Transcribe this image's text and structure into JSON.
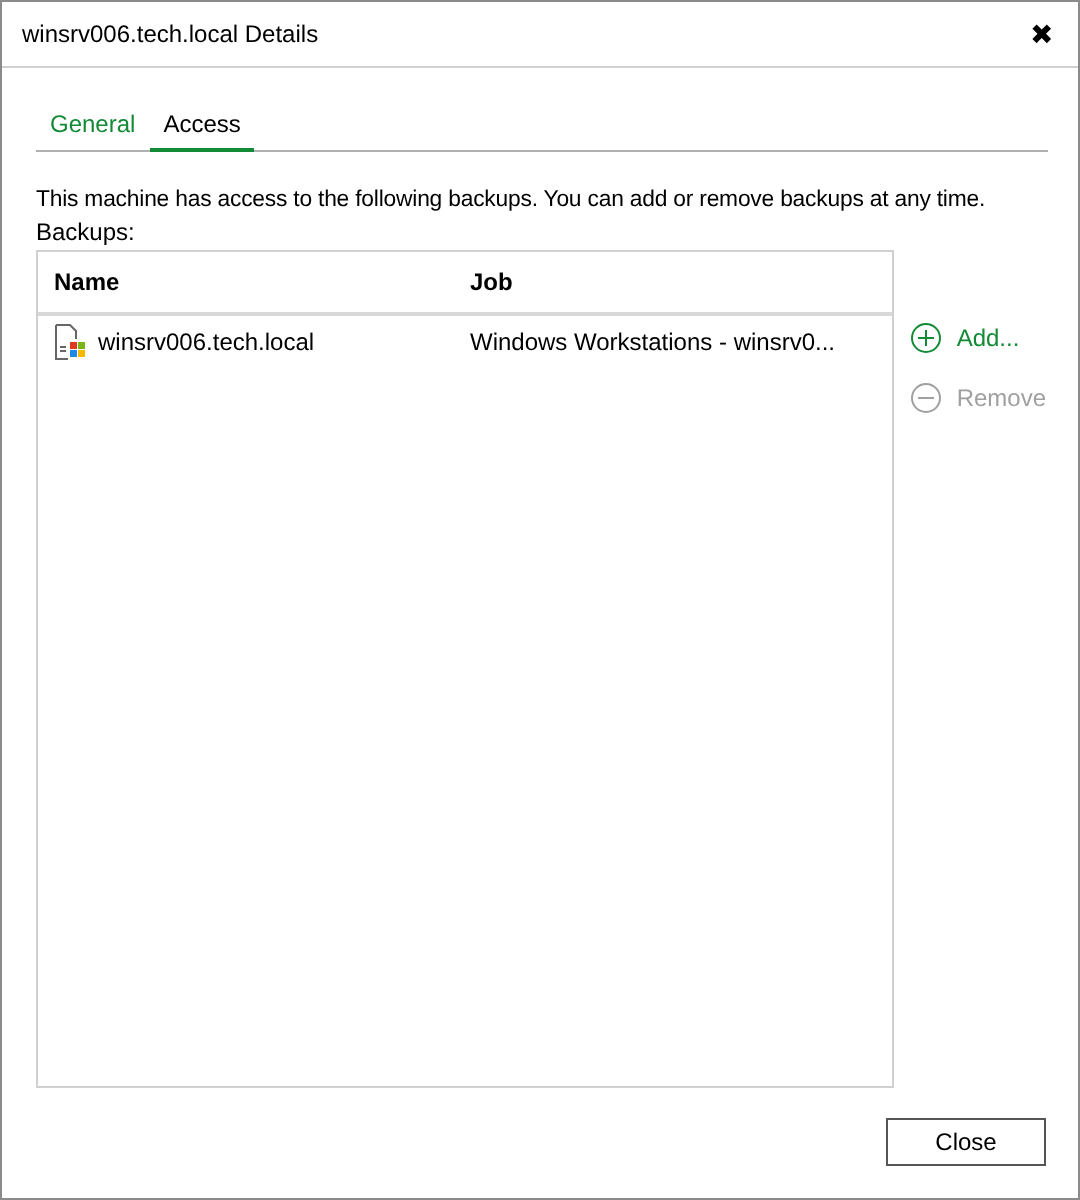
{
  "window": {
    "title": "winsrv006.tech.local Details",
    "close": "✖"
  },
  "tabs": [
    {
      "label": "General",
      "selected": false
    },
    {
      "label": "Access",
      "selected": true
    }
  ],
  "description": "This machine has access to the following backups. You can add or remove backups at any time.",
  "backups_label": "Backups:",
  "table": {
    "columns": [
      "Name",
      "Job"
    ],
    "rows": [
      {
        "name": "winsrv006.tech.local",
        "job": "Windows Workstations - winsrv0...",
        "selected": false
      }
    ]
  },
  "actions": [
    {
      "label": "Add...",
      "kind": "add",
      "disabled": false
    },
    {
      "label": "Remove",
      "kind": "remove",
      "disabled": true
    }
  ],
  "buttons": [
    "Close"
  ]
}
